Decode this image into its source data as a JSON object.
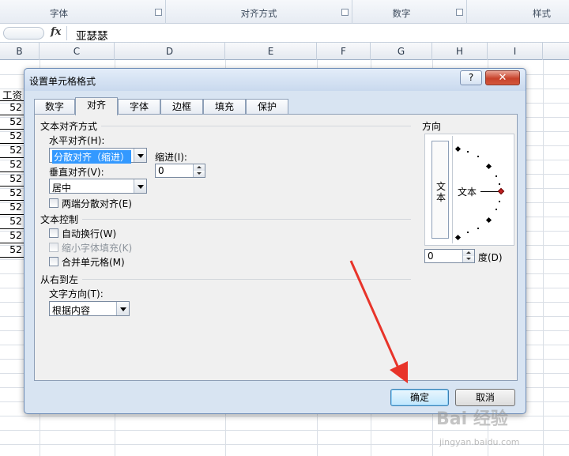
{
  "ribbon": {
    "groups": [
      {
        "label": "字体"
      },
      {
        "label": "对齐方式"
      },
      {
        "label": "数字"
      },
      {
        "label": "样式"
      }
    ]
  },
  "formula_bar": {
    "fx_label": "fx",
    "value": "亚瑟瑟"
  },
  "columns": [
    "B",
    "C",
    "D",
    "E",
    "F",
    "G",
    "H",
    "I"
  ],
  "sheet": {
    "header_cell": "工资",
    "values": [
      "52",
      "52",
      "52",
      "52",
      "52",
      "52",
      "52",
      "52",
      "52",
      "52",
      "52"
    ]
  },
  "dialog": {
    "title": "设置单元格格式",
    "help_label": "?",
    "close_label": "✕",
    "tabs": [
      {
        "label": "数字",
        "active": false
      },
      {
        "label": "对齐",
        "active": true
      },
      {
        "label": "字体",
        "active": false
      },
      {
        "label": "边框",
        "active": false
      },
      {
        "label": "填充",
        "active": false
      },
      {
        "label": "保护",
        "active": false
      }
    ],
    "text_alignment": {
      "section": "文本对齐方式",
      "horizontal_label": "水平对齐(H):",
      "horizontal_value": "分散对齐（缩进）",
      "vertical_label": "垂直对齐(V):",
      "vertical_value": "居中",
      "indent_label": "缩进(I):",
      "indent_value": "0",
      "justify_distributed": "两端分散对齐(E)"
    },
    "text_control": {
      "section": "文本控制",
      "wrap_text": "自动换行(W)",
      "shrink_to_fit": "缩小字体填充(K)",
      "merge_cells": "合并单元格(M)"
    },
    "rtl": {
      "section": "从右到左",
      "direction_label": "文字方向(T):",
      "direction_value": "根据内容"
    },
    "orientation": {
      "section": "方向",
      "vertical_text": [
        "文",
        "本"
      ],
      "dial_text": "文本",
      "degree_value": "0",
      "degree_label": "度(D)"
    },
    "ok_label": "确定",
    "cancel_label": "取消"
  },
  "watermark": {
    "brand": "Bai 经验",
    "url": "jingyan.baidu.com"
  },
  "colors": {
    "dialog_bg": "#d8e4f2",
    "panel_bg": "#f0f0f0",
    "selection": "#3399ff",
    "arrow": "#e8342a",
    "close_button": "#c7422b"
  }
}
